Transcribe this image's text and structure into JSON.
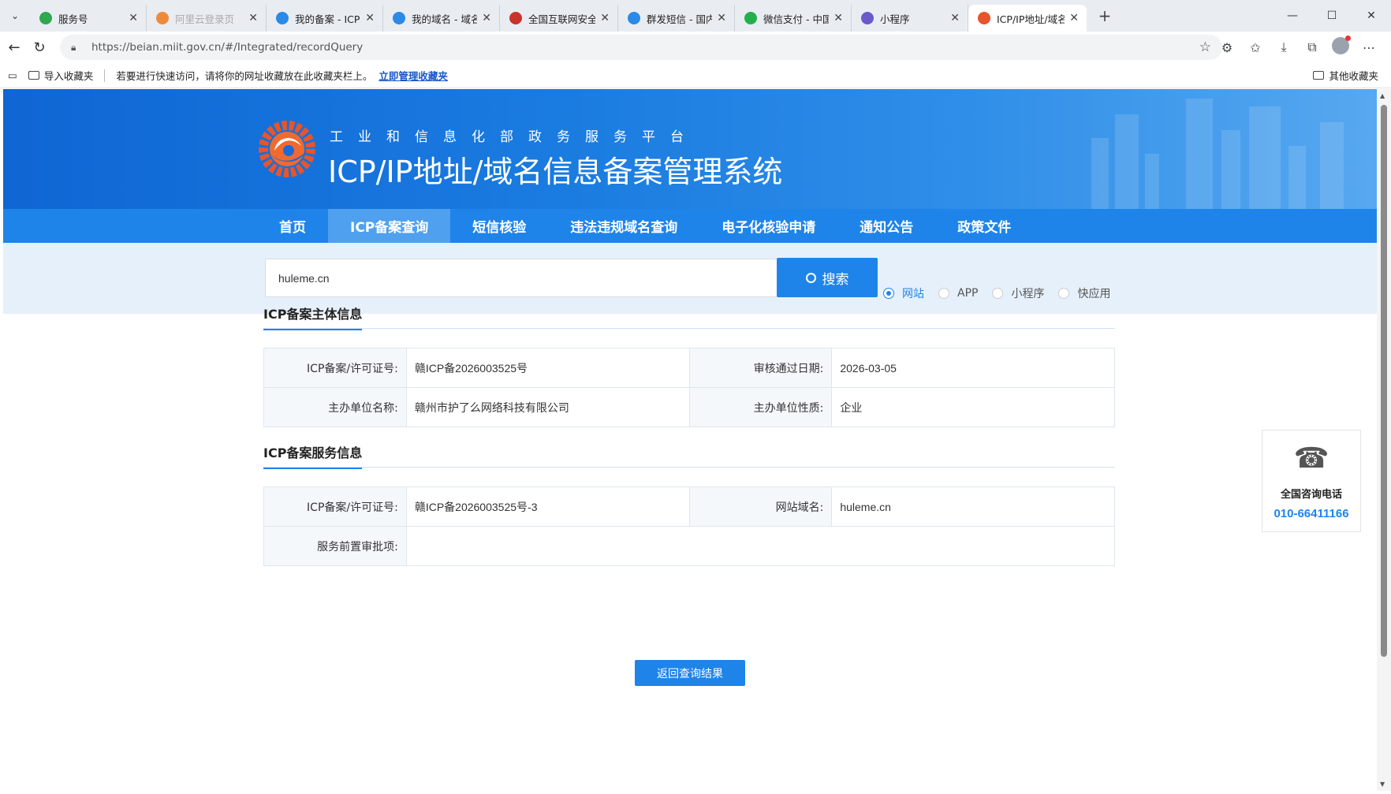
{
  "browser": {
    "tabs": [
      {
        "title": "服务号",
        "color": "#2fa84f",
        "active": false,
        "dim": false
      },
      {
        "title": "阿里云登录页",
        "color": "#f08a3b",
        "active": false,
        "dim": true
      },
      {
        "title": "我的备案 - ICP备案",
        "color": "#2b8ae8",
        "active": false,
        "dim": false
      },
      {
        "title": "我的域名 - 域名注册",
        "color": "#2b8ae8",
        "active": false,
        "dim": false
      },
      {
        "title": "全国互联网安全管理",
        "color": "#c8342b",
        "active": false,
        "dim": false
      },
      {
        "title": "群发短信 - 国内短信",
        "color": "#2b8ae8",
        "active": false,
        "dim": false
      },
      {
        "title": "微信支付 - 中国领先",
        "color": "#22b04b",
        "active": false,
        "dim": false
      },
      {
        "title": "小程序",
        "color": "#6a5acd",
        "active": false,
        "dim": false
      },
      {
        "title": "ICP/IP地址/域名信息",
        "color": "#e8542b",
        "active": true,
        "dim": false
      }
    ],
    "url": "https://beian.miit.gov.cn/#/Integrated/recordQuery",
    "favbar": {
      "import": "导入收藏夹",
      "hint": "若要进行快速访问，请将你的网址收藏放在此收藏夹栏上。",
      "manage_link": "立即管理收藏夹",
      "other": "其他收藏夹"
    }
  },
  "header": {
    "subtitle": "工业和信息化部政务服务平台",
    "title": "ICP/IP地址/域名信息备案管理系统"
  },
  "nav": {
    "items": [
      "首页",
      "ICP备案查询",
      "短信核验",
      "违法违规域名查询",
      "电子化核验申请",
      "通知公告",
      "政策文件"
    ],
    "active_index": 1
  },
  "search": {
    "value": "huleme.cn",
    "button_label": "搜索",
    "types": [
      "网站",
      "APP",
      "小程序",
      "快应用"
    ],
    "selected_type": "网站"
  },
  "subject_info": {
    "title": "ICP备案主体信息",
    "rows": [
      {
        "k1": "ICP备案/许可证号:",
        "v1": "赣ICP备2026003525号",
        "k2": "审核通过日期:",
        "v2": "2026-03-05"
      },
      {
        "k1": "主办单位名称:",
        "v1": "赣州市护了么网络科技有限公司",
        "k2": "主办单位性质:",
        "v2": "企业"
      }
    ]
  },
  "service_info": {
    "title": "ICP备案服务信息",
    "row1": {
      "k1": "ICP备案/许可证号:",
      "v1": "赣ICP备2026003525号-3",
      "k2": "网站域名:",
      "v2": "huleme.cn"
    },
    "row2": {
      "k": "服务前置审批项:",
      "v": ""
    }
  },
  "back_button": "返回查询结果",
  "hotline": {
    "label": "全国咨询电话",
    "number": "010-66411166"
  },
  "colors": {
    "primary": "#1f84ea",
    "banner_dark": "#0f66d4"
  }
}
